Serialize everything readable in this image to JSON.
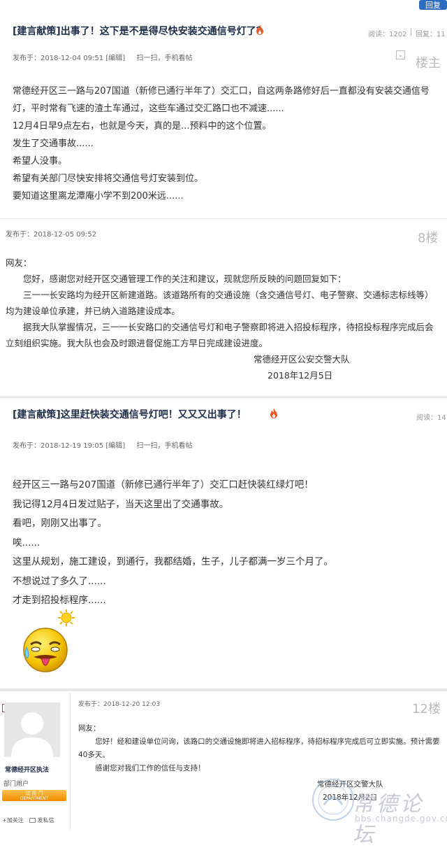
{
  "top": {
    "reply_label": "回复"
  },
  "post1": {
    "title": "[建言献策]出事了！这下是不是得尽快安装交通信号灯了？",
    "read_label": "阅读：1202",
    "reply_count_label": "回复：11",
    "meta_time": "发布于：2018-12-04 09:51",
    "edit_label": "[编辑]",
    "scan_label": "扫一扫，手机看帖",
    "floor": "楼主",
    "lines": [
      "常德经开区三一路与207国道（新修已通行半年了）交汇口，自这两条路修好后一直都没有安装交通信号灯，平时常有飞速的渣土车通过，这些车通过交汇路口也不减速......",
      "12月4日早9点左右，也就是今天，真的是...预料中的这个位置。",
      "发生了交通事故......",
      "希望人没事。",
      "希望有关部门尽快安排将交通信号灯安装到位。",
      "要知道这里离龙潭庵小学不到200米远......"
    ]
  },
  "reply8": {
    "meta_time": "发布于：2018-12-05 09:52",
    "floor": "8楼",
    "greeting": "网友：",
    "paragraphs": [
      "您好，感谢您对经开区交通管理工作的关注和建议，现就您所反映的问题回复如下：",
      "三一一长安路均为经开区新建道路。该道路所有的交通设施（含交通信号灯、电子警察、交通标志标线等）均为建设单位承建，并已纳入道路建设成本。",
      "据我大队掌握情况，三一一长安路口的交通信号灯和电子警察即将进入招投标程序，待招投标程序完成后会立刻组织实施。我大队也会及时跟进督促施工方早日完成建设进度。"
    ],
    "signature": "常德经开区公安交警大队",
    "date": "2018年12月5日"
  },
  "post2": {
    "title": "[建言献策]这里赶快装交通信号灯吧！又又又出事了！",
    "read_label": "阅读：14",
    "meta_time": "发布于：2018-12-19 19:05",
    "edit_label": "[编辑]",
    "scan_label": "扫一扫，手机看帖",
    "lines": [
      "经开区三一路与207国道（新修已通行半年了）交汇口赶快装红绿灯吧！",
      "我记得12月4日发过贴子，当天这里出了交通事故。",
      "看吧，刚刚又出事了。",
      "唉......",
      "这里从规划，施工建设，到通行，我都结婚，生子，儿子都满一岁三个月了。",
      "不想说过了多久了......",
      "才走到招投标程序......"
    ]
  },
  "reply12": {
    "user_name": "常德经开区执法",
    "user_group": "部门用户",
    "badge_label": "试 用 门",
    "badge_sub": "DEPARTMENT",
    "follow_label": "+加关注",
    "message_label": "发私信",
    "meta_time": "发布于：2018-12-20 12:03",
    "floor": "12楼",
    "greeting": "网友：",
    "paragraphs": [
      "您好！经和建设单位问询，该路口的交通设施即将进入招标程序，待招标程序完成后可立即实施。预计需要40多天。",
      "感谢您对我们工作的信任与支持！"
    ],
    "signature": "常德经开区交警大队",
    "date": "2018年12月2日"
  },
  "watermark": {
    "site_name": "常德论坛",
    "url": "bbs.changde.gov.cn"
  },
  "colors": {
    "title": "#1e2d4a",
    "reply_button": "#2c6bbf",
    "flame": "#e8592a",
    "badge": "#f39c12"
  }
}
